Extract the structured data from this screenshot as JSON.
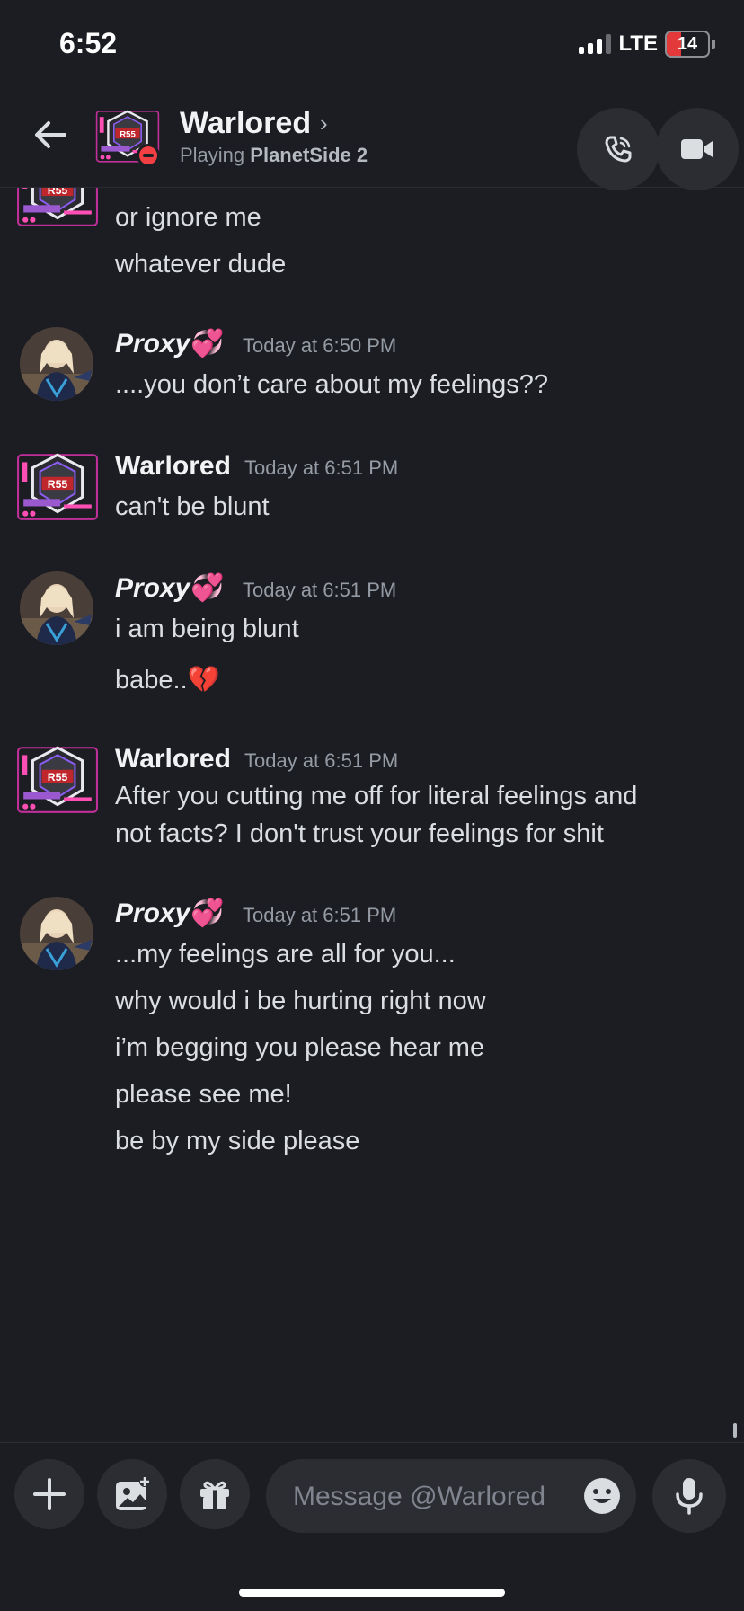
{
  "status_bar": {
    "time": "6:52",
    "network": "LTE",
    "battery": "14"
  },
  "header": {
    "name": "Warlored",
    "chevron": "›",
    "activity_prefix": "Playing",
    "activity_game": "PlanetSide 2",
    "icons": [
      "back-arrow-icon",
      "call-icon",
      "video-icon"
    ]
  },
  "messages": {
    "cont0": {
      "lines": [
        "or ignore me",
        "whatever dude"
      ]
    },
    "m1": {
      "author": "Proxy",
      "hearts": "💞",
      "timestamp": "Today at 6:50 PM",
      "lines": [
        "....you don’t care about my feelings??"
      ]
    },
    "m2": {
      "author": "Warlored",
      "timestamp": "Today at 6:51 PM",
      "lines": [
        "can't be blunt"
      ]
    },
    "m3": {
      "author": "Proxy",
      "hearts": "💞",
      "timestamp": "Today at 6:51 PM",
      "lines": [
        "i am being blunt",
        "babe..💔"
      ]
    },
    "m4": {
      "author": "Warlored",
      "timestamp": "Today at 6:51 PM",
      "lines": [
        "After you cutting me off for literal feelings and",
        "not facts? I don't trust your feelings for shit"
      ]
    },
    "m5": {
      "author": "Proxy",
      "hearts": "💞",
      "timestamp": "Today at 6:51 PM",
      "lines": [
        "...my feelings are all for you...",
        "why would i be hurting right now",
        "i’m begging you please hear me",
        "please see me!",
        "be by my side please"
      ]
    }
  },
  "composer": {
    "placeholder": "Message @Warlored",
    "icons": [
      "plus-icon",
      "image-icon",
      "gift-icon",
      "emoji-icon",
      "microphone-icon"
    ]
  },
  "colors": {
    "background": "#1c1d22",
    "dnd": "#f23f43",
    "hearts": "#eb459e"
  }
}
